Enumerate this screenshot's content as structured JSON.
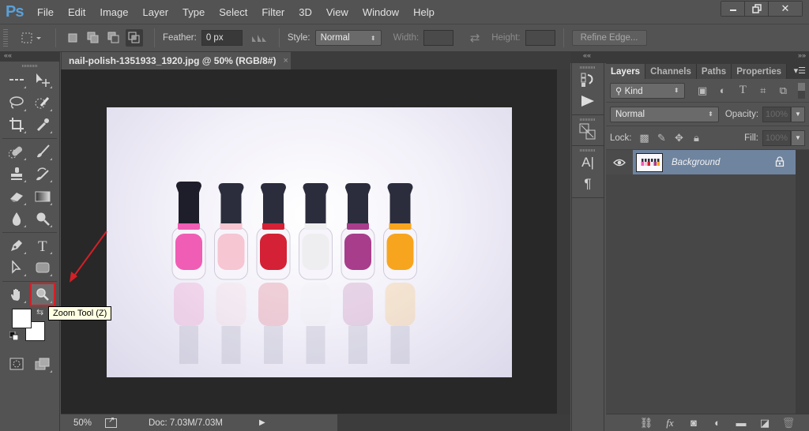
{
  "app": {
    "logo": "Ps",
    "menu": [
      "File",
      "Edit",
      "Image",
      "Layer",
      "Type",
      "Select",
      "Filter",
      "3D",
      "View",
      "Window",
      "Help"
    ],
    "window_controls": {
      "minimize": "minimize-icon",
      "restore": "restore-icon",
      "close": "✕"
    }
  },
  "options_bar": {
    "tool_icon": "rectangular-marquee-icon",
    "selection_modes": [
      "new-selection",
      "add-to-selection",
      "subtract-from-selection",
      "intersect-with-selection"
    ],
    "active_mode": "intersect-with-selection",
    "feather_label": "Feather:",
    "feather_value": "0 px",
    "anti_alias_icon": "anti-alias-icon",
    "style_label": "Style:",
    "style_value": "Normal",
    "width_label": "Width:",
    "width_value": "",
    "swap_icon": "⇄",
    "height_label": "Height:",
    "height_value": "",
    "refine_edge_label": "Refine Edge..."
  },
  "document": {
    "tab_title": "nail-polish-1351933_1920.jpg @ 50% (RGB/8#)",
    "tab_close": "×",
    "zoom_level": "50%",
    "doc_size": "Doc: 7.03M/7.03M",
    "image_alt": "Six nail polish bottles on white reflective surface",
    "bottle_colors": [
      "#f05db4",
      "#f6c6d2",
      "#d42135",
      "#eeeef0",
      "#a83d8c",
      "#f7a51e"
    ]
  },
  "toolbar": {
    "collapse": "««",
    "tools": [
      [
        "rectangular-marquee",
        "move"
      ],
      [
        "lasso",
        "quick-selection"
      ],
      [
        "crop",
        "eyedropper"
      ],
      [
        "spot-healing-brush",
        "brush"
      ],
      [
        "clone-stamp",
        "history-brush"
      ],
      [
        "eraser",
        "gradient"
      ],
      [
        "blur",
        "dodge"
      ],
      [
        "pen",
        "type"
      ],
      [
        "path-selection",
        "rectangle"
      ],
      [
        "hand",
        "zoom"
      ]
    ],
    "selected_tool": "zoom",
    "foreground_color": "#ffffff",
    "background_color": "#ffffff"
  },
  "tooltip": {
    "text": "Zoom Tool (Z)",
    "annotation_color": "#d61f26"
  },
  "mini_dock": {
    "collapse": "««",
    "expand": "»»",
    "buttons": [
      "history",
      "actions",
      "clone-source",
      "character",
      "paragraph"
    ]
  },
  "layers_panel": {
    "tabs": [
      "Layers",
      "Channels",
      "Paths",
      "Properties"
    ],
    "active_tab": "Layers",
    "filter_kind": "Kind",
    "blend_mode": "Normal",
    "opacity_label": "Opacity:",
    "opacity_value": "100%",
    "lock_label": "Lock:",
    "fill_label": "Fill:",
    "fill_value": "100%",
    "layers": [
      {
        "name": "Background",
        "visible": true,
        "locked": true,
        "selected": true
      }
    ],
    "footer_icons": [
      "link-layers",
      "fx",
      "add-mask",
      "adjustment-layer",
      "new-group",
      "new-layer",
      "delete-layer"
    ]
  }
}
